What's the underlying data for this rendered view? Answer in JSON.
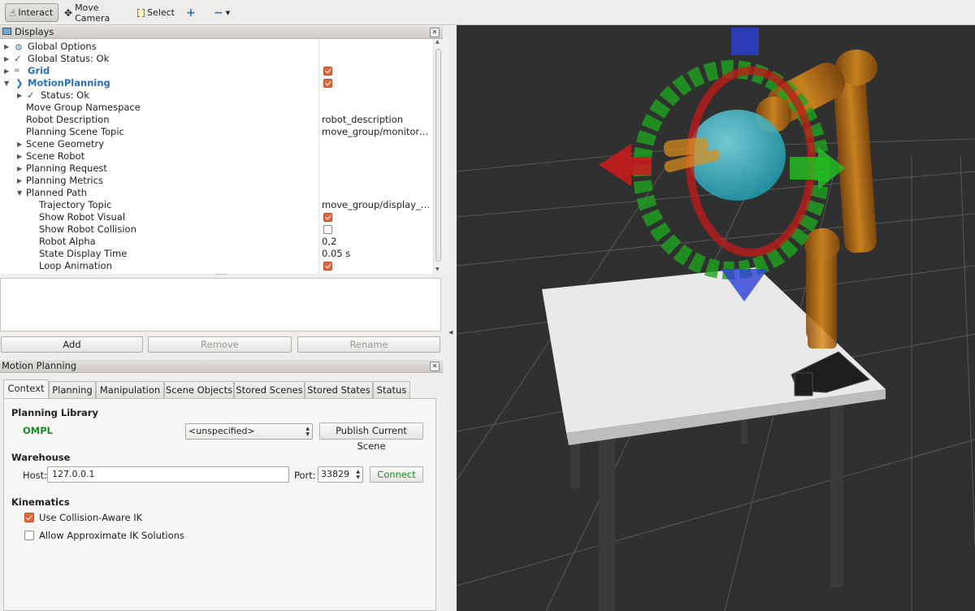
{
  "toolbar": {
    "interact": "Interact",
    "move_camera": "Move Camera",
    "select": "Select"
  },
  "displays": {
    "title": "Displays",
    "rows": [
      {
        "label": "Global Options",
        "value": ""
      },
      {
        "label": "Global Status: Ok",
        "value": ""
      },
      {
        "label": "Grid",
        "value": ""
      },
      {
        "label": "MotionPlanning",
        "value": ""
      },
      {
        "label": "Status: Ok",
        "value": ""
      },
      {
        "label": "Move Group Namespace",
        "value": ""
      },
      {
        "label": "Robot Description",
        "value": "robot_description"
      },
      {
        "label": "Planning Scene Topic",
        "value": "move_group/monitore..."
      },
      {
        "label": "Scene Geometry",
        "value": ""
      },
      {
        "label": "Scene Robot",
        "value": ""
      },
      {
        "label": "Planning Request",
        "value": ""
      },
      {
        "label": "Planning Metrics",
        "value": ""
      },
      {
        "label": "Planned Path",
        "value": ""
      },
      {
        "label": "Trajectory Topic",
        "value": "move_group/display_p..."
      },
      {
        "label": "Show Robot Visual",
        "value": ""
      },
      {
        "label": "Show Robot Collision",
        "value": ""
      },
      {
        "label": "Robot Alpha",
        "value": "0,2"
      },
      {
        "label": "State Display Time",
        "value": "0.05 s"
      },
      {
        "label": "Loop Animation",
        "value": ""
      }
    ],
    "checks": {
      "grid": true,
      "motion_planning": true,
      "show_robot_visual": true,
      "show_robot_collision": false,
      "loop_animation": true
    }
  },
  "buttons": {
    "add": "Add",
    "remove": "Remove",
    "rename": "Rename"
  },
  "motion_planning": {
    "title": "Motion Planning",
    "tabs": [
      "Context",
      "Planning",
      "Manipulation",
      "Scene Objects",
      "Stored Scenes",
      "Stored States",
      "Status"
    ],
    "selected_tab": "Context",
    "planning_library": {
      "heading": "Planning Library",
      "library": "OMPL",
      "planner_select": "<unspecified>",
      "publish_button": "Publish Current Scene"
    },
    "warehouse": {
      "heading": "Warehouse",
      "host_label": "Host:",
      "host_value": "127.0.0.1",
      "port_label": "Port:",
      "port_value": "33829",
      "connect_button": "Connect"
    },
    "kinematics": {
      "heading": "Kinematics",
      "collision_aware_ik": "Use Collision-Aware IK",
      "collision_aware_ik_checked": true,
      "approx_ik": "Allow Approximate IK Solutions",
      "approx_ik_checked": false
    }
  },
  "colors": {
    "accent_orange": "#e2663e",
    "motion_planning_blue": "#2a6fb7",
    "ompl_green": "#1d8a2a",
    "connect_green": "#1d8a2a",
    "viewport_bg": "#303030"
  }
}
